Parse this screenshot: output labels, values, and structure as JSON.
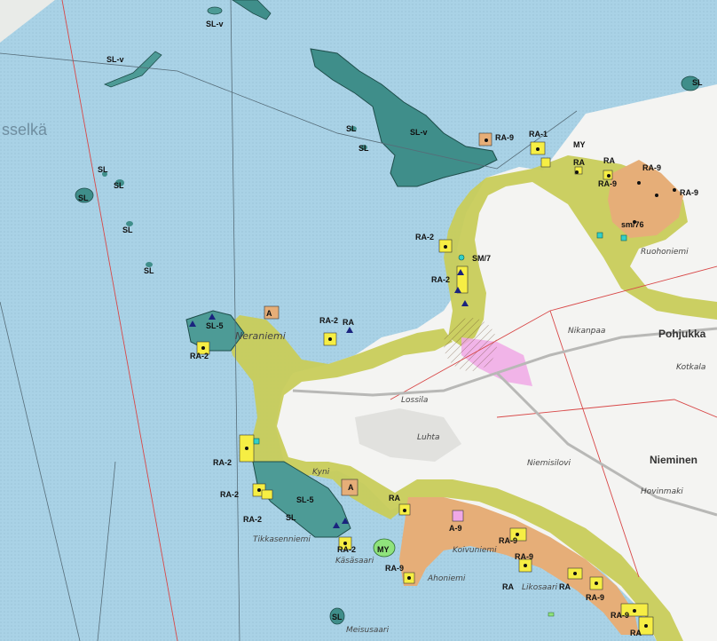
{
  "colors": {
    "water": "#a9d2e6",
    "land": "#f4f4f2",
    "yellow_zone": "#c8cc5a",
    "orange_zone": "#e6ae78",
    "protection": "#3f8e8a",
    "teal_light": "#4d9b96",
    "holiday_plot": "#f6ee44",
    "pink": "#f0a8e6",
    "green_area": "#8fe37c",
    "border_red": "#d84848"
  },
  "place_names": {
    "water_body": "sselkä",
    "village_1": "Pohjukka",
    "village_2": "Nieminen",
    "peninsula": "Neraniemi",
    "lake_area": "Luhta",
    "locality_1": "Kyni",
    "locality_2": "Niemisilovi",
    "locality_3": "Hovinmaki",
    "island_1": "Tikkasenniemi",
    "island_2": "Käsäsaari",
    "island_3": "Ahoniemi",
    "island_4": "Koivuniemi",
    "island_5": "Likosaari",
    "island_6": "Meisusaari",
    "island_7": "Ruohoniemi",
    "locality_4": "Lossila",
    "locality_5": "Nikanpaa",
    "locality_6": "Kotkala"
  },
  "zone_labels": {
    "slv_top": "SL-v",
    "slv_left": "SL-v",
    "slv_main": "SL-v",
    "sl_1": "SL",
    "sl_2": "SL",
    "sl_3": "SL",
    "sl_4": "SL",
    "sl_5": "SL",
    "sl_6": "SL",
    "sl_7": "SL",
    "sl_8": "SL",
    "sl_9": "SL",
    "sl_right": "SL",
    "sl5_a": "SL-5",
    "sl5_b": "SL-5",
    "ra9_1": "RA-9",
    "ra1": "RA-1",
    "my_1": "MY",
    "ra_1": "RA",
    "ra_2": "RA",
    "ra9_2": "RA-9",
    "ra9_3": "RA-9",
    "ra9_4": "RA-9",
    "sm76": "sm/76",
    "ra2_1": "RA-2",
    "sm7": "SM/7",
    "ra2_2": "RA-2",
    "ra2_3": "RA-2",
    "ra2_4": "RA-2",
    "ra2_5": "RA-2",
    "ra2_6": "RA-2",
    "ra2_7": "RA-2",
    "ra2_8": "RA-2",
    "ra_3": "RA",
    "a9": "A-9",
    "ra9_5": "RA-9",
    "my_2": "MY",
    "ra9_6": "RA-9",
    "ra9_7": "RA-9",
    "ra_4": "RA",
    "ra9_8": "RA-9",
    "ra_5": "RA",
    "ra9_9": "RA-9",
    "ra_6": "RA",
    "ra_7": "RA",
    "a_1": "A",
    "a_2": "A"
  }
}
